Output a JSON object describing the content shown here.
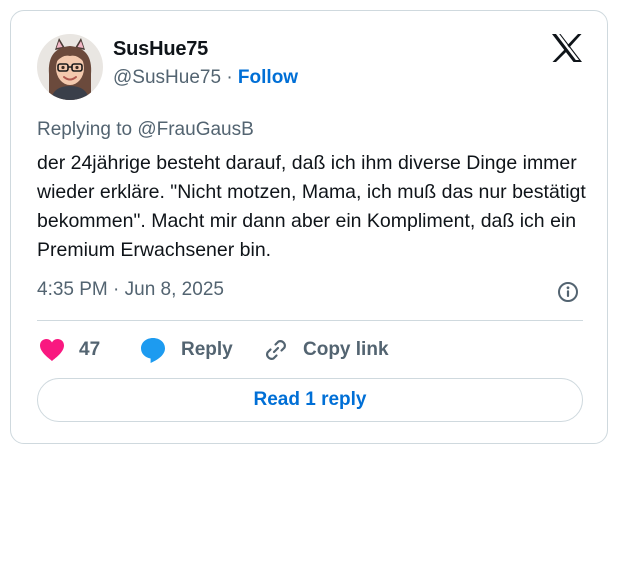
{
  "author": {
    "name": "SusHue75",
    "handle": "@SusHue75",
    "separator": "·",
    "follow_label": "Follow"
  },
  "tweet": {
    "replying_to": "Replying to @FrauGausB",
    "text": "der 24jährige besteht darauf, daß ich ihm diverse Dinge immer wieder erkläre. \"Nicht motzen, Mama, ich muß das nur bestätigt bekommen\". Macht mir dann aber ein Kompliment, daß ich ein Premium Erwachsener bin.",
    "timestamp": "4:35 PM · Jun 8, 2025"
  },
  "actions": {
    "like_count": "47",
    "reply_label": "Reply",
    "copy_link_label": "Copy link",
    "read_replies_label": "Read 1 reply"
  },
  "icons": {
    "brand": "x-logo-icon",
    "like": "heart-icon",
    "reply": "speech-bubble-icon",
    "copy": "link-icon",
    "info": "info-icon"
  },
  "colors": {
    "heart": "#f91880",
    "reply_bubble": "#1d9bf0",
    "link_blue": "#006fd6",
    "secondary_text": "#536471",
    "border": "#cfd9de"
  }
}
